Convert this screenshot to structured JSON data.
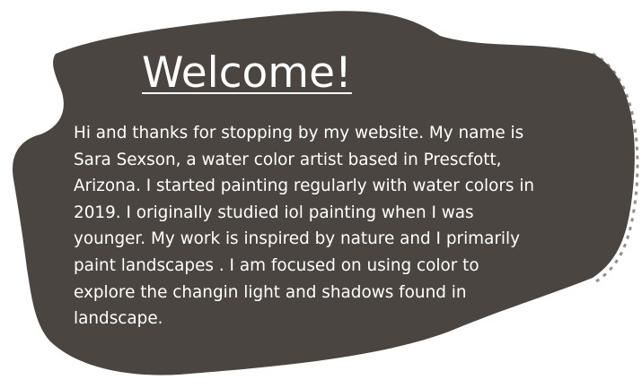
{
  "heading": "Welcome!",
  "intro_text": "Hi and thanks for stopping by my website. My name is\nSara Sexson, a water color artist based in Prescfott,\nArizona. I started painting regularly with water colors in\n2019.  I originally studied iol painting when I was\nyounger. My work is inspired by nature and I primarily\npaint landscapes . I am focused on using color to\nexplore the changin light and shadows found in\nlandscape.",
  "colors": {
    "blob_fill": "#4b4541",
    "text": "#ffffff",
    "background": "#ffffff"
  }
}
